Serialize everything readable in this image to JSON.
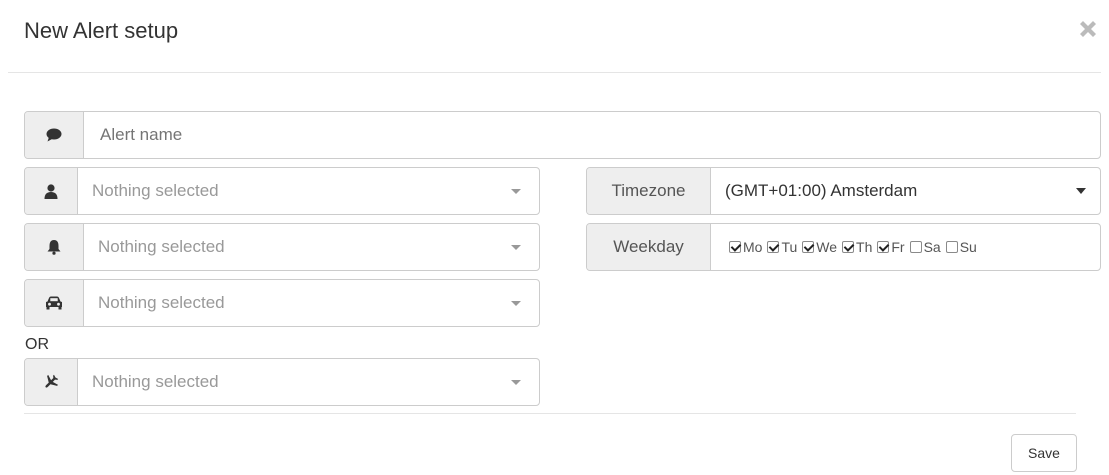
{
  "modal": {
    "title": "New Alert setup"
  },
  "alert_name": {
    "placeholder": "Alert name"
  },
  "selects": {
    "user": {
      "text": "Nothing selected"
    },
    "alarm": {
      "text": "Nothing selected"
    },
    "vehicle": {
      "text": "Nothing selected"
    },
    "flight": {
      "text": "Nothing selected"
    }
  },
  "or_label": "OR",
  "timezone": {
    "label": "Timezone",
    "value": "(GMT+01:00) Amsterdam"
  },
  "weekday": {
    "label": "Weekday",
    "days": [
      {
        "label": "Mo",
        "checked": true
      },
      {
        "label": "Tu",
        "checked": true
      },
      {
        "label": "We",
        "checked": true
      },
      {
        "label": "Th",
        "checked": true
      },
      {
        "label": "Fr",
        "checked": true
      },
      {
        "label": "Sa",
        "checked": false
      },
      {
        "label": "Su",
        "checked": false
      }
    ]
  },
  "footer": {
    "save_label": "Save"
  },
  "icons": {
    "name": "comment-icon",
    "user": "user-icon",
    "alarm": "bell-icon",
    "vehicle": "car-icon",
    "flight": "plane-icon",
    "close": "close-icon"
  },
  "colors": {
    "addon_bg": "#eeeeee",
    "border": "#cccccc",
    "placeholder": "#999999"
  }
}
